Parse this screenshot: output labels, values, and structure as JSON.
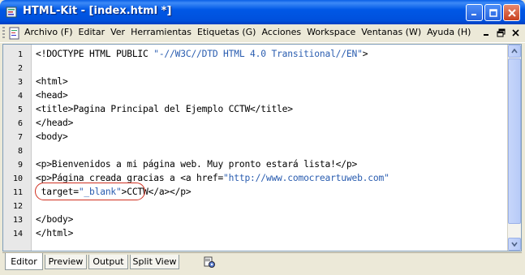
{
  "window": {
    "title": "HTML-Kit - [index.html *]",
    "app_icon": "html-kit-icon"
  },
  "title_buttons": {
    "minimize_icon": "minimize-icon",
    "maximize_icon": "maximize-icon",
    "close_icon": "close-icon"
  },
  "menu": {
    "items": [
      {
        "label": "Archivo (F)"
      },
      {
        "label": "Editar"
      },
      {
        "label": "Ver"
      },
      {
        "label": "Herramientas"
      },
      {
        "label": "Etiquetas (G)"
      },
      {
        "label": "Acciones"
      },
      {
        "label": "Workspace"
      },
      {
        "label": "Ventanas (W)"
      },
      {
        "label": "Ayuda (H)"
      }
    ]
  },
  "editor": {
    "lines": [
      {
        "n": "1",
        "text": "<!DOCTYPE HTML PUBLIC \"-//W3C//DTD HTML 4.0 Transitional//EN\">"
      },
      {
        "n": "2",
        "text": ""
      },
      {
        "n": "3",
        "text": "<html>"
      },
      {
        "n": "4",
        "text": "<head>"
      },
      {
        "n": "5",
        "text": "<title>Pagina Principal del Ejemplo CCTW</title>"
      },
      {
        "n": "6",
        "text": "</head>"
      },
      {
        "n": "7",
        "text": "<body>"
      },
      {
        "n": "8",
        "text": ""
      },
      {
        "n": "9",
        "text": "<p>Bienvenidos a mi página web. Muy pronto estará lista!</p>"
      },
      {
        "n": "10",
        "text": "<p>Página creada gracias a <a href=\"http://www.comocreartuweb.com\""
      },
      {
        "n": "11",
        "text": " target=\"_blank\">CCTW</a></p>"
      },
      {
        "n": "12",
        "text": ""
      },
      {
        "n": "13",
        "text": "</body>"
      },
      {
        "n": "14",
        "text": "</html>"
      }
    ],
    "string_color": "#2a5db0",
    "highlight_color": "#d03020"
  },
  "tabs": [
    {
      "label": "Editor",
      "active": true
    },
    {
      "label": "Preview",
      "active": false
    },
    {
      "label": "Output",
      "active": false
    },
    {
      "label": "Split View",
      "active": false
    }
  ],
  "tab_tool_icon": "gear-document-icon"
}
